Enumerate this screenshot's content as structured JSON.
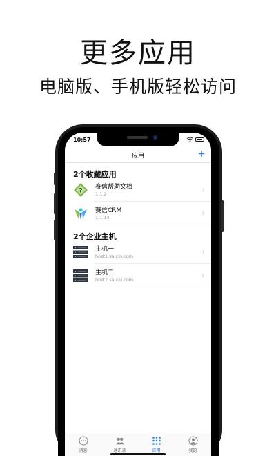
{
  "promo": {
    "headline": "更多应用",
    "subheadline": "电脑版、手机版轻松访问"
  },
  "status_bar": {
    "time": "10:57"
  },
  "nav": {
    "title": "应用",
    "add_label": "+"
  },
  "favorites": {
    "title": "2个收藏应用",
    "items": [
      {
        "name": "赛信帮助文档",
        "version": "1.1.2",
        "icon": "help-doc-icon"
      },
      {
        "name": "赛信CRM",
        "version": "1.1.14",
        "icon": "crm-icon"
      }
    ]
  },
  "hosts": {
    "title": "2个企业主机",
    "items": [
      {
        "name": "主机一",
        "address": "host1.saixin.com",
        "icon": "server-icon"
      },
      {
        "name": "主机二",
        "address": "host2.saixin.com",
        "icon": "server-icon"
      }
    ]
  },
  "tabs": [
    {
      "label": "消息",
      "icon": "chat-bubble-icon",
      "active": false
    },
    {
      "label": "通讯录",
      "icon": "contacts-icon",
      "active": false
    },
    {
      "label": "应用",
      "icon": "apps-grid-icon",
      "active": true
    },
    {
      "label": "我的",
      "icon": "profile-icon",
      "active": false
    }
  ],
  "colors": {
    "accent": "#2b7de9",
    "help_icon_green": "#7cb342",
    "server_dark": "#2f3640"
  }
}
